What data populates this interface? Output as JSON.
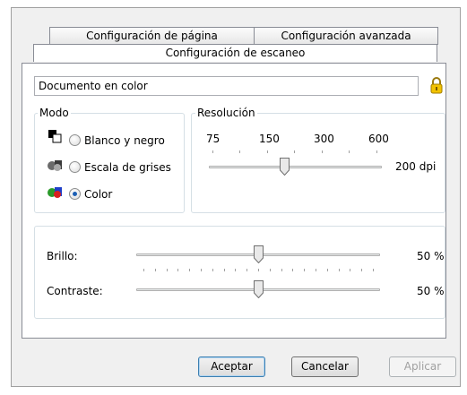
{
  "tabs": {
    "row1": [
      "Configuración de página",
      "Configuración avanzada"
    ],
    "row2": [
      "Configuración de escaneo"
    ]
  },
  "preset": {
    "value": "Documento en color"
  },
  "mode": {
    "legend": "Modo",
    "options": [
      {
        "label": "Blanco y negro",
        "checked": false,
        "icon": "bw-mode-icon"
      },
      {
        "label": "Escala de grises",
        "checked": false,
        "icon": "grayscale-mode-icon"
      },
      {
        "label": "Color",
        "checked": true,
        "icon": "color-mode-icon"
      }
    ]
  },
  "resolution": {
    "legend": "Resolución",
    "marks": [
      "75",
      "150",
      "300",
      "600"
    ],
    "value_text": "200 dpi",
    "value": 200
  },
  "adjustments": {
    "brightness": {
      "label": "Brillo:",
      "value_text": "50 %",
      "value": 50
    },
    "contrast": {
      "label": "Contraste:",
      "value_text": "50 %",
      "value": 50
    }
  },
  "buttons": {
    "ok": "Aceptar",
    "cancel": "Cancelar",
    "apply": "Aplicar"
  },
  "colors": {
    "accent": "#1c5fb4",
    "lock": "#e8b400"
  }
}
